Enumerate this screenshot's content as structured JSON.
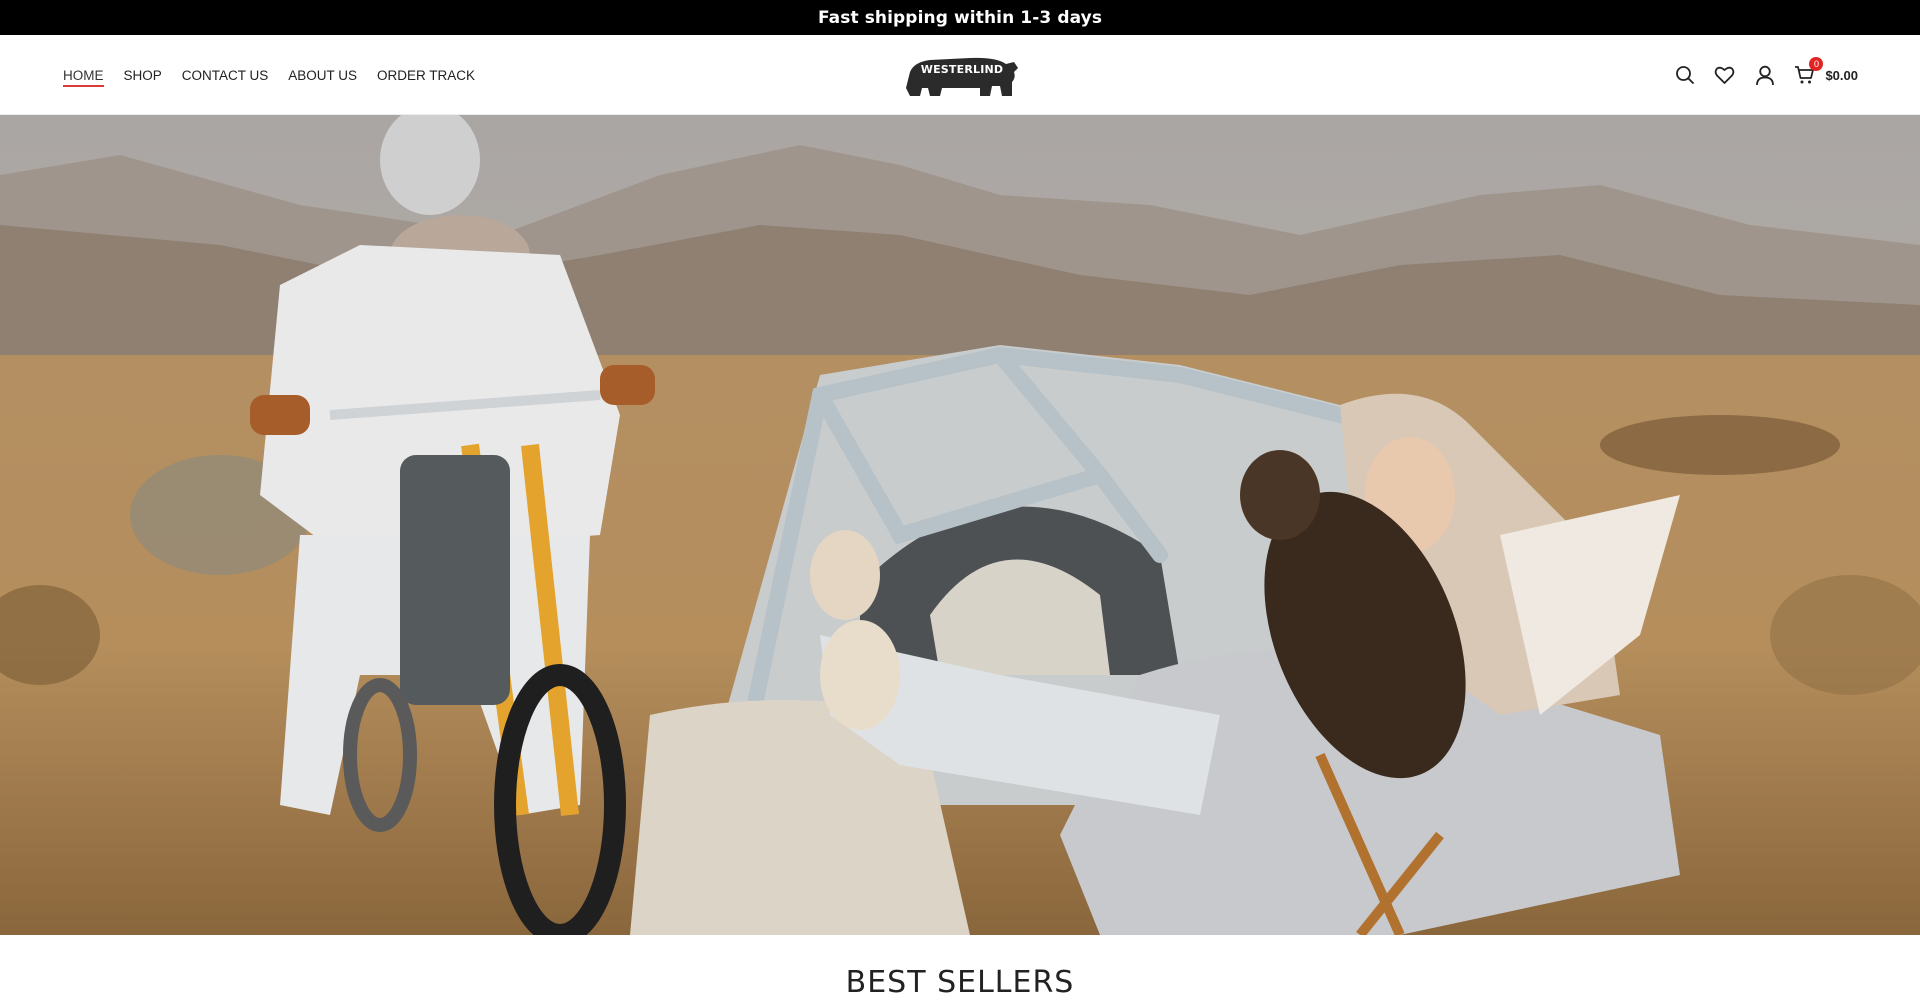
{
  "announcement": {
    "text": "Fast shipping within 1-3 days"
  },
  "nav": {
    "items": [
      {
        "label": "HOME",
        "active": true
      },
      {
        "label": "SHOP",
        "active": false
      },
      {
        "label": "CONTACT US",
        "active": false
      },
      {
        "label": "ABOUT US",
        "active": false
      },
      {
        "label": "ORDER TRACK",
        "active": false
      }
    ]
  },
  "logo": {
    "text": "WESTERLIND"
  },
  "header_icons": {
    "search": "search-icon",
    "wishlist": "heart-icon",
    "account": "user-icon",
    "cart": "cart-icon",
    "cart_count": "0",
    "cart_total": "$0.00"
  },
  "hero": {
    "description": "Outdoor desert scene with motorbike rider, geodesic tent, and person with owl"
  },
  "section": {
    "title": "BEST SELLERS"
  },
  "colors": {
    "topbar_bg": "#000000",
    "accent_red": "#d93a3a",
    "badge_red": "#e02424"
  }
}
